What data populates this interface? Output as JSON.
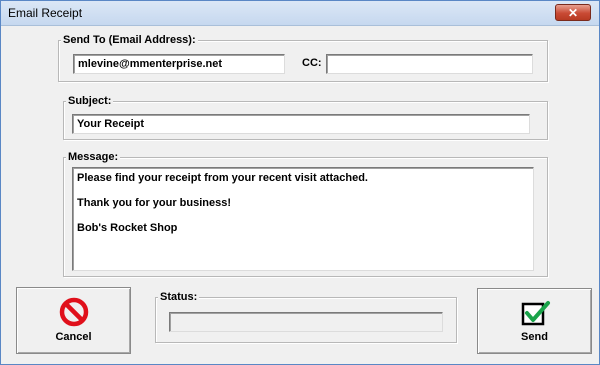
{
  "window": {
    "title": "Email Receipt",
    "close_glyph": "✕"
  },
  "send_to": {
    "legend": "Send To (Email Address):",
    "email_value": "mlevine@mmenterprise.net",
    "cc_label": "CC:",
    "cc_value": ""
  },
  "subject": {
    "legend": "Subject:",
    "value": "Your Receipt"
  },
  "message": {
    "legend": "Message:",
    "lines": [
      "Please find your receipt from your recent visit attached.",
      "Thank you for your business!",
      "Bob's Rocket Shop"
    ]
  },
  "status": {
    "legend": "Status:",
    "value": ""
  },
  "buttons": {
    "cancel_label": "Cancel",
    "send_label": "Send",
    "cancel_icon": "no-entry-icon",
    "send_icon": "checkbox-checked-icon"
  },
  "colors": {
    "cancel_red": "#e0101b",
    "send_green": "#1aa34a",
    "title_bar": "#c6d8ef"
  }
}
